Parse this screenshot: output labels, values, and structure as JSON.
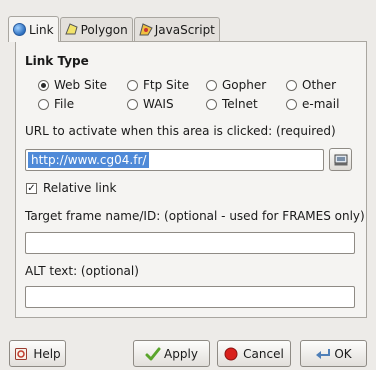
{
  "tabs": [
    {
      "label": "Link",
      "icon": "globe-icon",
      "active": true
    },
    {
      "label": "Polygon",
      "icon": "polygon-icon",
      "active": false
    },
    {
      "label": "JavaScript",
      "icon": "javascript-icon",
      "active": false
    }
  ],
  "link_type": {
    "title": "Link Type",
    "options": [
      {
        "label": "Web Site",
        "checked": true
      },
      {
        "label": "Ftp Site",
        "checked": false
      },
      {
        "label": "Gopher",
        "checked": false
      },
      {
        "label": "Other",
        "checked": false
      },
      {
        "label": "File",
        "checked": false
      },
      {
        "label": "WAIS",
        "checked": false
      },
      {
        "label": "Telnet",
        "checked": false
      },
      {
        "label": "e-mail",
        "checked": false
      }
    ]
  },
  "url": {
    "label": "URL to activate when this area is clicked: (required)",
    "value": "http://www.cg04.fr/"
  },
  "relative_link": {
    "label": "Relative link",
    "checked": true
  },
  "target_frame": {
    "label": "Target frame name/ID: (optional - used for FRAMES only)",
    "value": ""
  },
  "alt_text": {
    "label": "ALT text: (optional)",
    "value": ""
  },
  "buttons": {
    "help": "Help",
    "apply": "Apply",
    "cancel": "Cancel",
    "ok": "OK"
  },
  "colors": {
    "selection": "#4f8ad8",
    "cancel_icon": "#d9201c",
    "apply_icon": "#5aa52c"
  }
}
